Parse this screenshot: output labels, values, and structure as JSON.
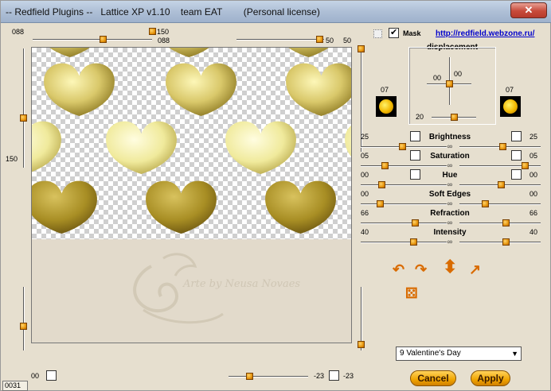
{
  "window": {
    "title": "-- Redfield Plugins --   Lattice XP v1.10    team EAT        (Personal license)",
    "close": "✕"
  },
  "top": {
    "left_value": "088",
    "top_center_value": "150",
    "center_value": "088",
    "right_slider_value": "50",
    "right_value": "50",
    "left_side_value": "150"
  },
  "mask": {
    "label": "Mask",
    "checked": true
  },
  "link": "http://redfield.webzone.ru/",
  "displacement": {
    "title": "displacement",
    "x": "00",
    "y": "00",
    "bottom": "20",
    "left_swatch_value": "07",
    "right_swatch_value": "07"
  },
  "params": [
    {
      "label": "Brightness",
      "left": "25",
      "right": "25"
    },
    {
      "label": "Saturation",
      "left": "05",
      "right": "05"
    },
    {
      "label": "Hue",
      "left": "00",
      "right": "00"
    },
    {
      "label": "Soft Edges",
      "left": "00",
      "right": "00"
    },
    {
      "label": "Refraction",
      "left": "66",
      "right": "66"
    },
    {
      "label": "Intensity",
      "left": "40",
      "right": "40"
    }
  ],
  "preset": {
    "selected": "9 Valentine's Day"
  },
  "buttons": {
    "cancel": "Cancel",
    "apply": "Apply"
  },
  "bottom": {
    "left_value": "00",
    "right_value": "-23",
    "far_right_value": "-23",
    "status": "0031"
  },
  "watermark": "Arte by Neusa Novaes",
  "colors": {
    "accent": "#f0a400",
    "heart": "#d8c860",
    "link": "#0000cc"
  }
}
